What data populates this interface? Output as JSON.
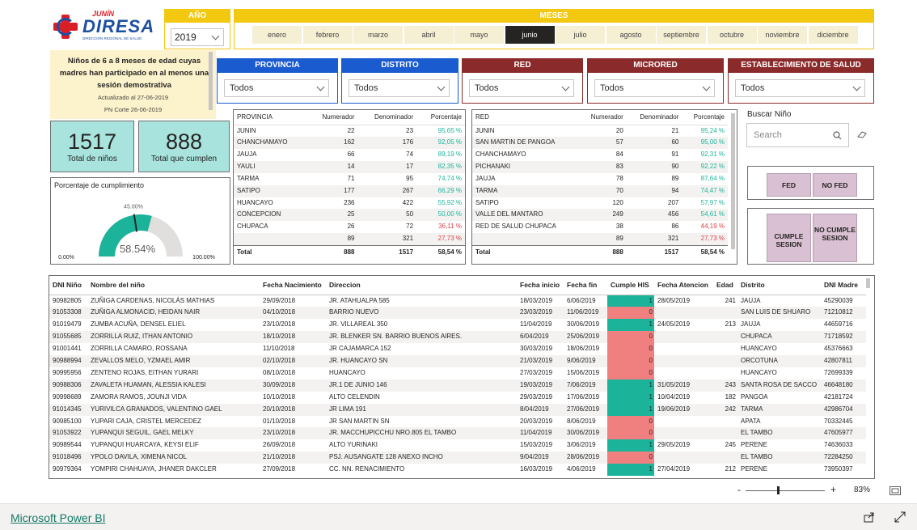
{
  "logo": {
    "top": "JUNÍN",
    "brand": "DIRESA",
    "sub": "DIRECCIÓN REGIONAL DE SALUD"
  },
  "year": {
    "header": "AÑO",
    "value": "2019"
  },
  "months": {
    "header": "MESES",
    "items": [
      "enero",
      "febrero",
      "marzo",
      "abril",
      "mayo",
      "junio",
      "julio",
      "agosto",
      "septiembre",
      "octubre",
      "noviembre",
      "diciembre"
    ],
    "selected": "junio"
  },
  "info": {
    "title": "Niños de 6 a 8 meses de edad cuyas madres han participado en al menos una sesión demostrativa",
    "updated": "Actualizado al  27-06-2019",
    "cut": "PN  Corte  26-06-2019"
  },
  "filters": [
    {
      "label": "PROVINCIA",
      "value": "Todos",
      "color": "#1a5bcf"
    },
    {
      "label": "DISTRITO",
      "value": "Todos",
      "color": "#1a5bcf"
    },
    {
      "label": "RED",
      "value": "Todos",
      "color": "#8b2a2a"
    },
    {
      "label": "MICRORED",
      "value": "Todos",
      "color": "#8b2a2a"
    },
    {
      "label": "ESTABLECIMIENTO DE SALUD",
      "value": "Todos",
      "color": "#8b2a2a"
    }
  ],
  "kpis": {
    "total_ninos": {
      "value": "1517",
      "label": "Total de niños"
    },
    "total_cumplen": {
      "value": "888",
      "label": "Total que cumplen"
    }
  },
  "gauge": {
    "title": "Porcentaje de cumplimiento",
    "value": 58.54,
    "value_label": "58.54%",
    "target_label": "45.00%",
    "target": 45,
    "min_label": "0.00%",
    "max_label": "100.00%"
  },
  "provincia_table": {
    "headers": [
      "PROVINCIA",
      "Numerador",
      "Denominador",
      "Porcentaje"
    ],
    "rows": [
      [
        "JUNIN",
        "22",
        "23",
        "95,65 %"
      ],
      [
        "CHANCHAMAYO",
        "162",
        "176",
        "92,05 %"
      ],
      [
        "JAUJA",
        "66",
        "74",
        "89,19 %"
      ],
      [
        "YAULI",
        "14",
        "17",
        "82,35 %"
      ],
      [
        "TARMA",
        "71",
        "95",
        "74,74 %"
      ],
      [
        "SATIPO",
        "177",
        "267",
        "66,29 %"
      ],
      [
        "HUANCAYO",
        "236",
        "422",
        "55,92 %"
      ],
      [
        "CONCEPCION",
        "25",
        "50",
        "50,00 %"
      ],
      [
        "CHUPACA",
        "26",
        "72",
        "36,11 %"
      ],
      [
        "",
        "89",
        "321",
        "27,73 %"
      ]
    ],
    "total": [
      "Total",
      "888",
      "1517",
      "58,54 %"
    ]
  },
  "red_table": {
    "headers": [
      "RED",
      "Numerador",
      "Denominador",
      "Porcentaje"
    ],
    "rows": [
      [
        "JUNIN",
        "20",
        "21",
        "95,24 %"
      ],
      [
        "SAN MARTIN DE PANGOA",
        "57",
        "60",
        "95,00 %"
      ],
      [
        "CHANCHAMAYO",
        "84",
        "91",
        "92,31 %"
      ],
      [
        "PICHANAKI",
        "83",
        "90",
        "92,22 %"
      ],
      [
        "JAUJA",
        "78",
        "89",
        "87,64 %"
      ],
      [
        "TARMA",
        "70",
        "94",
        "74,47 %"
      ],
      [
        "SATIPO",
        "120",
        "207",
        "57,97 %"
      ],
      [
        "VALLE DEL MANTARO",
        "249",
        "456",
        "54,61 %"
      ],
      [
        "RED DE SALUD CHUPACA",
        "38",
        "86",
        "44,19 %"
      ],
      [
        "",
        "89",
        "321",
        "27,73 %"
      ]
    ],
    "total": [
      "Total",
      "888",
      "1517",
      "58,54 %"
    ]
  },
  "search": {
    "label": "Buscar Niño",
    "placeholder": "Search"
  },
  "fed_buttons": {
    "fed": "FED",
    "no_fed": "NO FED"
  },
  "sesion_buttons": {
    "cumple": "CUMPLE SESION",
    "no_cumple": "NO CUMPLE SESION"
  },
  "main_table": {
    "headers": [
      "DNI Niño",
      "Nombre del niño",
      "Fecha Nacimiento",
      "Direccion",
      "Fecha inicio",
      "Fecha fin",
      "Cumple HIS",
      "Fecha Atencion",
      "Edad",
      "Distrito",
      "DNI Madre"
    ],
    "rows": [
      [
        "90982805",
        "ZUÑIGA CARDENAS, NICOLÁS MATHIAS",
        "29/09/2018",
        "JR. ATAHUALPA 585",
        "18/03/2019",
        "6/06/2019",
        "1",
        "28/05/2019",
        "241",
        "JAUJA",
        "45290039"
      ],
      [
        "91053308",
        "ZUÑIGA ALMONACID, HEIDAN NAIR",
        "04/10/2018",
        "BARRIO NUEVO",
        "23/03/2019",
        "11/06/2019",
        "0",
        "",
        "",
        "SAN LUIS DE SHUARO",
        "71210812"
      ],
      [
        "91019479",
        "ZUMBA ACUÑA, DENSEL ELIEL",
        "23/10/2018",
        "JR. VILLAREAL 350",
        "11/04/2019",
        "30/06/2019",
        "1",
        "24/05/2019",
        "213",
        "JAUJA",
        "44659716"
      ],
      [
        "91055685",
        "ZORRILLA RUIZ, ITHAN ANTONIO",
        "18/10/2018",
        "JR. BLENKER SN. BARRIO BUENOS AIRES.",
        "6/04/2019",
        "25/06/2019",
        "0",
        "",
        "",
        "CHUPACA",
        "71718592"
      ],
      [
        "91001441",
        "ZORRILLA CAMARO, ROSSANA",
        "11/10/2018",
        "JR CAJAMARCA 152",
        "30/03/2019",
        "18/06/2019",
        "0",
        "",
        "",
        "HUANCAYO",
        "45376663"
      ],
      [
        "90988994",
        "ZEVALLOS MELO, YZMAEL AMIR",
        "02/10/2018",
        "JR. HUANCAYO SN",
        "21/03/2019",
        "9/06/2019",
        "0",
        "",
        "",
        "ORCOTUNA",
        "42807811"
      ],
      [
        "90995956",
        "ZENTENO ROJAS, EITHAN YURARI",
        "08/10/2018",
        "HUANCAYO",
        "27/03/2019",
        "15/06/2019",
        "0",
        "",
        "",
        "HUANCAYO",
        "72699339"
      ],
      [
        "90988306",
        "ZAVALETA HUAMAN, ALESSIA KALESI",
        "30/09/2018",
        "JR.1 DE JUNIO 146",
        "19/03/2019",
        "7/06/2019",
        "1",
        "31/05/2019",
        "243",
        "SANTA ROSA DE SACCO",
        "46648180"
      ],
      [
        "90998689",
        "ZAMORA RAMOS, JOUNJI VIDA",
        "10/10/2018",
        "ALTO CELENDIN",
        "29/03/2019",
        "17/06/2019",
        "1",
        "10/04/2019",
        "182",
        "PANGOA",
        "42181724"
      ],
      [
        "91014345",
        "YURIVILCA GRANADOS, VALENTINO GAEL",
        "20/10/2018",
        "JR LIMA 191",
        "8/04/2019",
        "27/06/2019",
        "1",
        "19/06/2019",
        "242",
        "TARMA",
        "42986704"
      ],
      [
        "90985100",
        "YUPARI CAJA, CRISTEL MERCEDEZ",
        "01/10/2018",
        "JR SAN MARTIN SN",
        "20/03/2019",
        "8/06/2019",
        "0",
        "",
        "",
        "APATA",
        "70332445"
      ],
      [
        "91053922",
        "YUPANQUI SEGUIL, GAEL MELKY",
        "23/10/2018",
        "JR. MACCHUPICCHU NRO.805 EL TAMBO",
        "11/04/2019",
        "30/06/2019",
        "0",
        "",
        "",
        "EL TAMBO",
        "47605977"
      ],
      [
        "90989544",
        "YUPANQUI HUARCAYA, KEYSI ELIF",
        "26/09/2018",
        "ALTO YURINAKI",
        "15/03/2019",
        "3/06/2019",
        "1",
        "29/05/2019",
        "245",
        "PERENE",
        "74636033"
      ],
      [
        "91018496",
        "YPOLO DAVILA, XIMENA NICOL",
        "21/10/2018",
        "PSJ. AUSANGATE 128 ANEXO INCHO",
        "9/04/2019",
        "28/06/2019",
        "0",
        "",
        "",
        "EL TAMBO",
        "72284250"
      ],
      [
        "90979364",
        "YOMPIRI CHAHUAYA, JHANER DAKCLER",
        "27/09/2018",
        "CC. NN. RENACIMIENTO",
        "16/03/2019",
        "4/06/2019",
        "1",
        "27/04/2019",
        "212",
        "PERENE",
        "73950397"
      ]
    ]
  },
  "zoom": {
    "minus": "-",
    "plus": "+",
    "value": "83%"
  },
  "footer": {
    "link": "Microsoft Power BI"
  },
  "colors": {
    "yellow": "#f2c811",
    "teal": "#1bb39a",
    "red": "#f08080",
    "kpi": "#a8e3dd",
    "blue": "#1a5bcf",
    "maroon": "#8b2a2a"
  }
}
